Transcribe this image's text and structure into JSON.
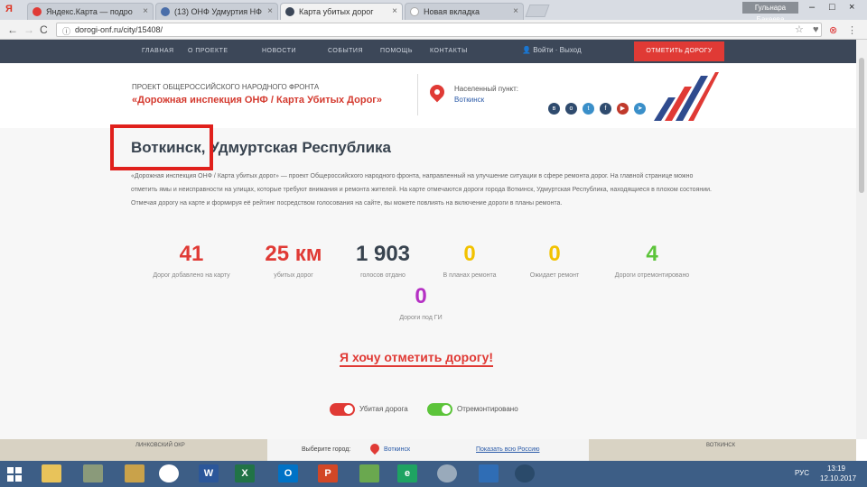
{
  "browser": {
    "tabs": [
      {
        "label": "Яндекс.Карта — подро",
        "icon": "yandex-icon",
        "color": "#e03a35"
      },
      {
        "label": "(13) ОНФ Удмуртия НФ",
        "icon": "globe-icon",
        "color": "#4a6ea9"
      },
      {
        "label": "Карта убитых дорог",
        "icon": "road-icon",
        "color": "#3c4758"
      },
      {
        "label": "Новая вкладка",
        "icon": "blank-icon",
        "color": "#ffffff"
      }
    ],
    "browser_logo": "Я",
    "tab_close": "×",
    "profile": "Гульнара Бакеева",
    "win_min": "–",
    "win_max": "□",
    "win_close": "×",
    "nav_back": "←",
    "nav_forward": "→",
    "nav_reload": "C",
    "url_info": "ⓘ",
    "url": "dorogi-onf.ru/city/15408/",
    "bookmark": "☆",
    "ext1": "♥",
    "ext2": "⊗",
    "menu": "⋮"
  },
  "sitenav": {
    "items": [
      "ГЛАВНАЯ",
      "О ПРОЕКТЕ",
      "НОВОСТИ",
      "СОБЫТИЯ",
      "ПОМОЩЬ",
      "КОНТАКТЫ"
    ],
    "user": "Войти · Выход",
    "cta": "ОТМЕТИТЬ ДОРОГУ"
  },
  "header": {
    "subtitle": "ПРОЕКТ ОБЩЕРОССИЙСКОГО НАРОДНОГО ФРОНТА",
    "title": "«Дорожная инспекция ОНФ / Карта Убитых Дорог»",
    "location_label": "Населенный пункт:",
    "location_value": "Воткинск",
    "social": [
      "vk",
      "ok",
      "tw",
      "fb",
      "yt",
      "tg"
    ]
  },
  "main": {
    "city_title": "Воткинск, Удмуртская Республика",
    "description": "«Дорожная инспекция ОНФ / Карта убитых дорог» — проект Общероссийского народного фронта, направленный на улучшение ситуации в сфере ремонта дорог. На главной странице можно отметить ямы и неисправности на улицах, которые требуют внимания и ремонта жителей. На карте отмечаются дороги города Воткинск, Удмуртская Республика, находящиеся в плохом состоянии. Отмечая дорогу на карте и формируя её рейтинг посредством голосования на сайте, вы можете повлиять на включение дороги в планы ремонта.",
    "stats": [
      {
        "value": "41",
        "label": "Дорог добавлено на карту",
        "color": "#e03a35"
      },
      {
        "value": "25 км",
        "label": "убитых дорог",
        "color": "#e03a35"
      },
      {
        "value": "1 903",
        "label": "голосов отдано",
        "color": "#38434f"
      },
      {
        "value": "0",
        "label": "В планах ремонта",
        "color": "#f2c200"
      },
      {
        "value": "0",
        "label": "Ожидает ремонт",
        "color": "#f2c200"
      },
      {
        "value": "4",
        "label": "Дороги отремонтировано",
        "color": "#5cc43a"
      }
    ],
    "stat_extra": {
      "value": "0",
      "label": "Дороги под ГИ",
      "color": "#b530c4"
    },
    "cta_link": "Я хочу отметить дорогу!",
    "legend": [
      {
        "label": "Убитая дорога",
        "color": "#e03a35"
      },
      {
        "label": "Отремонтировано",
        "color": "#5cc43a"
      }
    ]
  },
  "footer": {
    "choose_city": "Выберите город:",
    "selected_city": "Воткинск",
    "show_russia": "Показать всю Россию",
    "map_left_text": "ЛИНКОВСКИЙ ОКР",
    "map_right_text": "ВОТКИНСК"
  },
  "taskbar": {
    "apps": [
      "explorer",
      "folder",
      "tools",
      "chrome",
      "word",
      "excel",
      "outlook",
      "powerpoint",
      "paint",
      "edge",
      "yandex",
      "vpn",
      "browser"
    ],
    "lang": "РУС",
    "time": "13:19",
    "date": "12.10.2017"
  }
}
